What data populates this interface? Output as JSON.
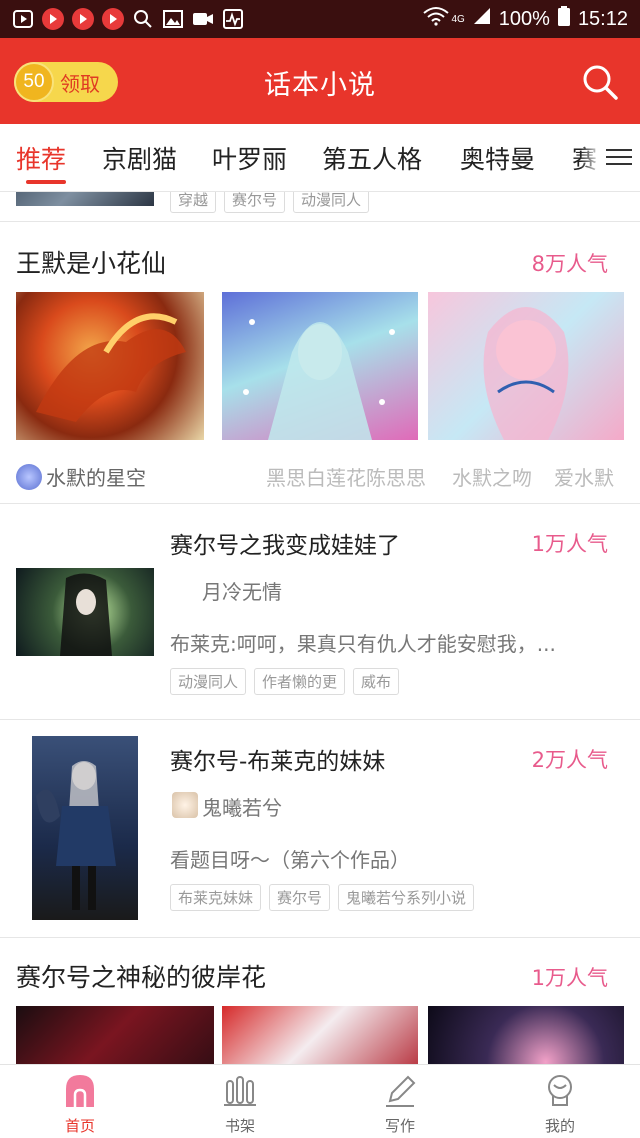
{
  "status_bar": {
    "battery": "100%",
    "time": "15:12",
    "network": "4G"
  },
  "header": {
    "coin_value": "50",
    "claim_label": "领取",
    "title": "话本小说"
  },
  "tabs": [
    {
      "label": "推荐"
    },
    {
      "label": "京剧猫"
    },
    {
      "label": "叶罗丽"
    },
    {
      "label": "第五人格"
    },
    {
      "label": "奥特曼"
    },
    {
      "label": "赛"
    }
  ],
  "partial_top": {
    "tags": [
      "穿越",
      "赛尔号",
      "动漫同人"
    ]
  },
  "group1": {
    "title": "王默是小花仙",
    "popularity": "8万人气",
    "primary_author": "水默的星空",
    "other_authors": [
      "黑思白莲花陈思思",
      "水默之吻",
      "爱水默"
    ]
  },
  "story1": {
    "title": "赛尔号之我变成娃娃了",
    "popularity": "1万人气",
    "author": "月冷无情",
    "excerpt": "布莱克:呵呵，果真只有仇人才能安慰我，...",
    "tags": [
      "动漫同人",
      "作者懒的更",
      "威布"
    ]
  },
  "story2": {
    "title": "赛尔号-布莱克的妹妹",
    "popularity": "2万人气",
    "author": "鬼曦若兮",
    "excerpt": "看题目呀～（第六个作品）",
    "tags": [
      "布莱克妹妹",
      "赛尔号",
      "鬼曦若兮系列小说"
    ]
  },
  "group2": {
    "title": "赛尔号之神秘的彼岸花",
    "popularity": "1万人气"
  },
  "bottom_nav": [
    {
      "label": "首页",
      "icon": "home-icon"
    },
    {
      "label": "书架",
      "icon": "bookshelf-icon"
    },
    {
      "label": "写作",
      "icon": "pen-icon"
    },
    {
      "label": "我的",
      "icon": "profile-icon"
    }
  ],
  "colors": {
    "brand_red": "#e8352b",
    "popularity_pink": "#e85b8c",
    "status_bar": "#3a0f0f",
    "coin_yellow": "#f6d74c"
  }
}
